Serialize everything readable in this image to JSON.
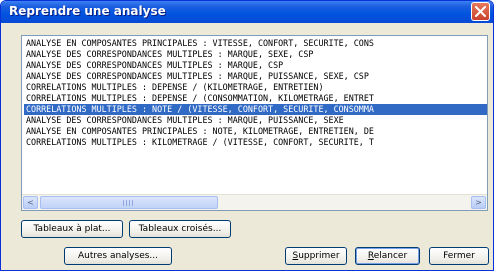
{
  "window": {
    "title": "Reprendre une analyse"
  },
  "list": {
    "items": [
      "ANALYSE EN COMPOSANTES PRINCIPALES : VITESSE, CONFORT, SECURITE, CONS",
      "ANALYSE DES CORRESPONDANCES MULTIPLES : MARQUE, SEXE, CSP",
      "ANALYSE DES CORRESPONDANCES MULTIPLES : MARQUE, CSP",
      "ANALYSE DES CORRESPONDANCES MULTIPLES : MARQUE, PUISSANCE, SEXE, CSP",
      "CORRELATIONS MULTIPLES : DEPENSE / (KILOMETRAGE, ENTRETIEN)",
      "CORRELATIONS MULTIPLES : DEPENSE / (CONSOMMATION, KILOMETRAGE, ENTRET",
      "CORRELATIONS MULTIPLES : NOTE / (VITESSE, CONFORT, SECURITE, CONSOMMA",
      "ANALYSE DES CORRESPONDANCES MULTIPLES : MARQUE, PUISSANCE, SEXE",
      "ANALYSE EN COMPOSANTES PRINCIPALES : NOTE, KILOMETRAGE, ENTRETIEN, DE",
      "CORRELATIONS MULTIPLES : KILOMETRAGE / (VITESSE, CONFORT, SECURITE, T"
    ],
    "selected_index": 6
  },
  "scrollbar": {
    "left_arrow": "<",
    "right_arrow": ">"
  },
  "buttons": {
    "tableaux_a_plat": "Tableaux à plat...",
    "tableaux_croises": "Tableaux croisés...",
    "autres_analyses": "Autres analyses...",
    "supprimer_mnemonic": "S",
    "supprimer_rest": "upprimer",
    "relancer_mnemonic": "R",
    "relancer_rest": "elancer",
    "fermer": "Fermer"
  },
  "colors": {
    "titlebar": "#0053e0",
    "selection": "#316ac5",
    "face": "#ece9d8",
    "close_button": "#c9412b"
  }
}
